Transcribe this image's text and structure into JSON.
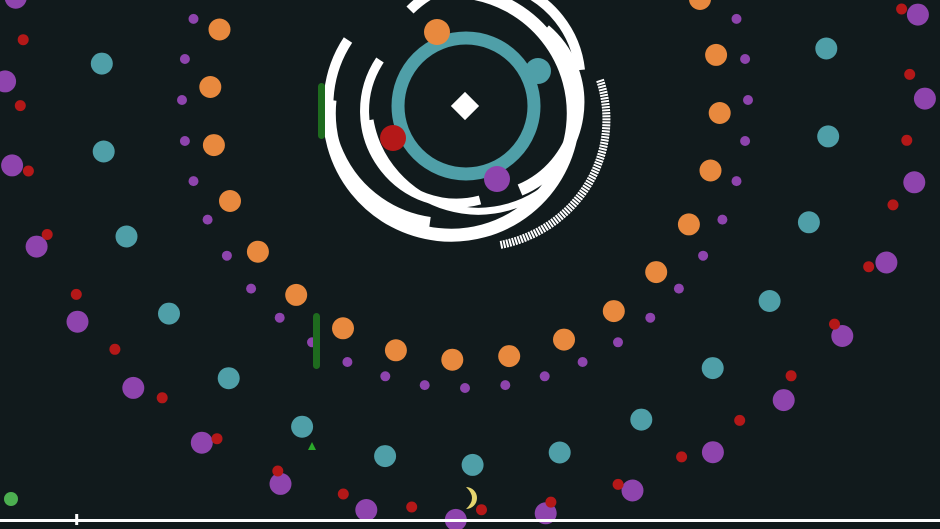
{
  "colors": {
    "background": "#111a1c",
    "teal": "#4f9fa8",
    "orange": "#e8893e",
    "purple": "#8e44ad",
    "red": "#b41818",
    "white": "#ffffff",
    "green_bar": "#1e6b1e",
    "green_dot": "#4caf50",
    "yellow": "#e6d56e"
  },
  "game": {
    "vortex_icon": "spiral-vortex-icon",
    "player_icon": "diamond-icon",
    "progress": 0.08
  }
}
